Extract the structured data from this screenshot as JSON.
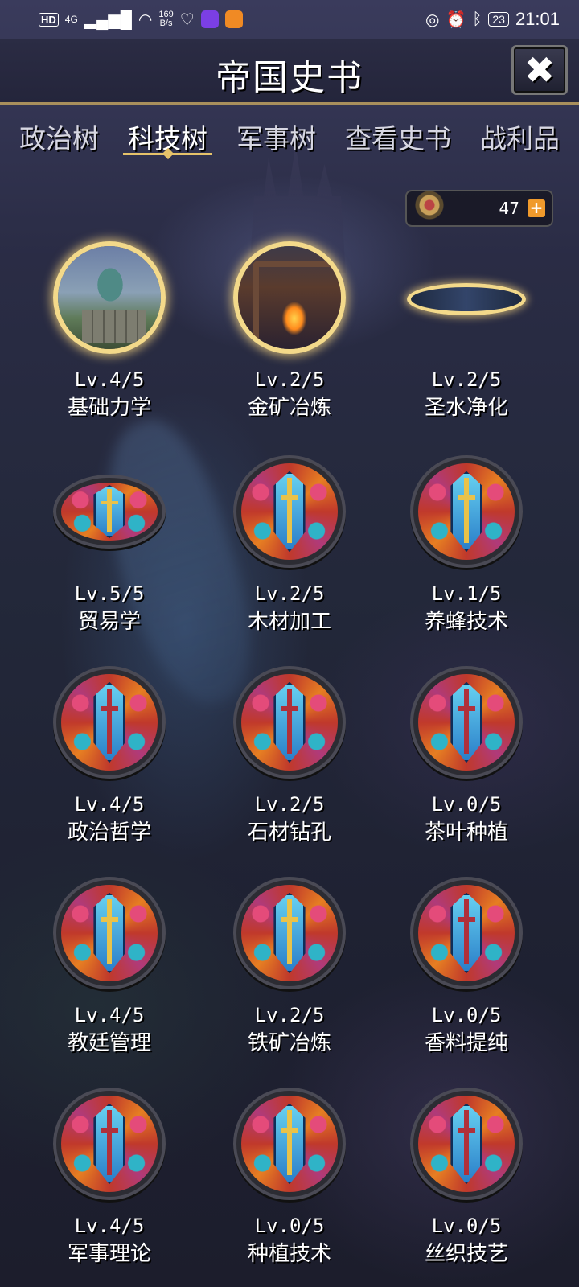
{
  "status_bar": {
    "network_type": "HD",
    "signal_label": "4G",
    "speed_value": "169",
    "speed_unit": "B/s",
    "battery": "23",
    "time": "21:01"
  },
  "header": {
    "title": "帝国史书",
    "close_label": "✖"
  },
  "tabs": [
    {
      "label": "政治树",
      "active": false
    },
    {
      "label": "科技树",
      "active": true
    },
    {
      "label": "军事树",
      "active": false
    },
    {
      "label": "查看史书",
      "active": false
    },
    {
      "label": "战利品",
      "active": false
    }
  ],
  "currency": {
    "amount": "47",
    "add_label": "+"
  },
  "techs": [
    {
      "level": "Lv.4/5",
      "name": "基础力学",
      "icon": "mechanics-statue-icon"
    },
    {
      "level": "Lv.2/5",
      "name": "金矿冶炼",
      "icon": "gold-smelting-forge-icon"
    },
    {
      "level": "Lv.2/5",
      "name": "圣水净化",
      "icon": "holy-water-chamber-icon"
    },
    {
      "level": "Lv.5/5",
      "name": "贸易学",
      "icon": "stained-glass-sword-icon"
    },
    {
      "level": "Lv.2/5",
      "name": "木材加工",
      "icon": "stained-glass-sword-icon"
    },
    {
      "level": "Lv.1/5",
      "name": "养蜂技术",
      "icon": "stained-glass-sword-icon"
    },
    {
      "level": "Lv.4/5",
      "name": "政治哲学",
      "icon": "stained-glass-sword-icon"
    },
    {
      "level": "Lv.2/5",
      "name": "石材钻孔",
      "icon": "stained-glass-sword-icon"
    },
    {
      "level": "Lv.0/5",
      "name": "茶叶种植",
      "icon": "stained-glass-sword-icon"
    },
    {
      "level": "Lv.4/5",
      "name": "教廷管理",
      "icon": "stained-glass-sword-icon"
    },
    {
      "level": "Lv.2/5",
      "name": "铁矿冶炼",
      "icon": "stained-glass-sword-icon"
    },
    {
      "level": "Lv.0/5",
      "name": "香料提纯",
      "icon": "stained-glass-sword-icon"
    },
    {
      "level": "Lv.4/5",
      "name": "军事理论",
      "icon": "stained-glass-sword-icon"
    },
    {
      "level": "Lv.0/5",
      "name": "种植技术",
      "icon": "stained-glass-sword-icon"
    },
    {
      "level": "Lv.0/5",
      "name": "丝织技艺",
      "icon": "stained-glass-sword-icon"
    }
  ]
}
